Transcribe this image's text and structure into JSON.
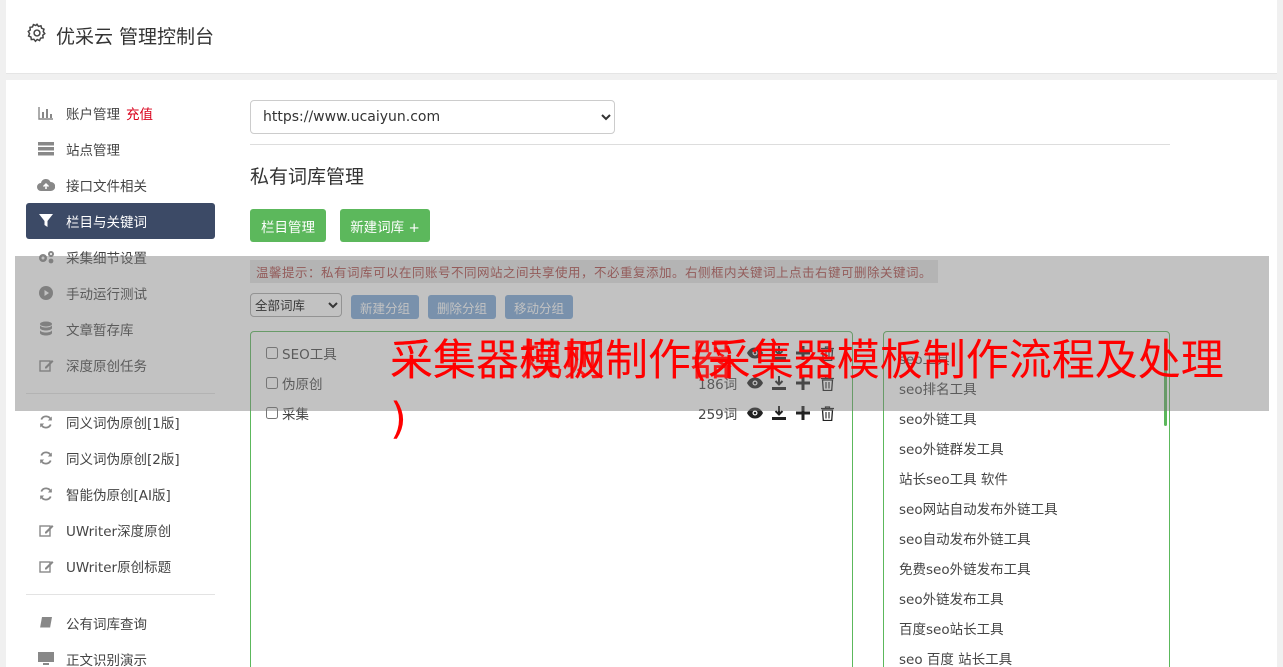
{
  "header": {
    "title": "优采云 管理控制台"
  },
  "sidebar": {
    "items": [
      {
        "icon": "bar-chart-icon",
        "label": "账户管理",
        "badge": "充值"
      },
      {
        "icon": "server-icon",
        "label": "站点管理"
      },
      {
        "icon": "cloud-upload-icon",
        "label": "接口文件相关"
      },
      {
        "icon": "filter-icon",
        "label": "栏目与关键词",
        "active": true
      },
      {
        "icon": "gears-icon",
        "label": "采集细节设置"
      },
      {
        "icon": "play-circle-icon",
        "label": "手动运行测试"
      },
      {
        "icon": "database-icon",
        "label": "文章暂存库"
      },
      {
        "icon": "edit-icon",
        "label": "深度原创任务"
      },
      {
        "icon": "refresh-icon",
        "label": "同义词伪原创[1版]"
      },
      {
        "icon": "refresh-icon",
        "label": "同义词伪原创[2版]"
      },
      {
        "icon": "refresh-icon",
        "label": "智能伪原创[AI版]"
      },
      {
        "icon": "edit-icon",
        "label": "UWriter深度原创"
      },
      {
        "icon": "edit-icon",
        "label": "UWriter原创标题"
      },
      {
        "icon": "book-icon",
        "label": "公有词库查询"
      },
      {
        "icon": "monitor-icon",
        "label": "正文识别演示"
      }
    ]
  },
  "main": {
    "site_select": {
      "value": "https://www.ucaiyun.com"
    },
    "section_title": "私有词库管理",
    "buttons": {
      "columns": "栏目管理",
      "new_library": "新建词库 +"
    },
    "tip": "温馨提示：私有词库可以在同账号不同网站之间共享使用，不必重复添加。右侧框内关键词上点击右键可删除关键词。",
    "library_filter": {
      "value": "全部词库"
    },
    "group_buttons": {
      "new": "新建分组",
      "delete": "删除分组",
      "move": "移动分组"
    },
    "libraries": [
      {
        "name": "SEO工具",
        "count": ""
      },
      {
        "name": "伪原创",
        "count": "186词"
      },
      {
        "name": "采集",
        "count": "259词"
      }
    ],
    "keywords": [
      "seo工具",
      "seo排名工具",
      "seo外链工具",
      "seo外链群发工具",
      "站长seo工具 软件",
      "seo网站自动发布外链工具",
      "seo自动发布外链工具",
      "免费seo外链发布工具",
      "seo外链发布工具",
      "百度seo站长工具",
      "seo 百度 站长工具"
    ]
  },
  "overlay": {
    "lines": [
      "采集器模板制作(采集器模板制作流程及处理",
      "采集",
      "规则",
      "器",
      ")"
    ]
  }
}
